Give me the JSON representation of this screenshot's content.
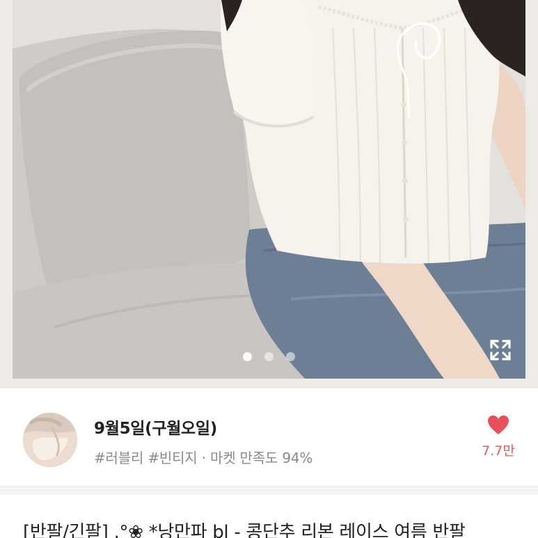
{
  "product": {
    "image_alt": "흰색 레이스 리본 반팔 블라우스 착용 사진",
    "image_count": 3,
    "active_image_index": 0,
    "title": "[반팔/긴팔] .°❀ *낭만파 bl - 콩단추 리본 레이스 여름 반팔"
  },
  "seller": {
    "name": "9월5일(구월오일)",
    "tags": "#러블리 #빈티지",
    "separator": "·",
    "satisfaction_label": "마켓 만족도",
    "satisfaction_value": "94%"
  },
  "like": {
    "count": "7.7만",
    "liked": true
  },
  "icons": {
    "expand": "expand-icon",
    "heart": "heart-icon"
  },
  "colors": {
    "heart": "#e8505b",
    "like_count": "#e85a5a",
    "meta_text": "#8a8a8a",
    "title_text": "#222222"
  }
}
